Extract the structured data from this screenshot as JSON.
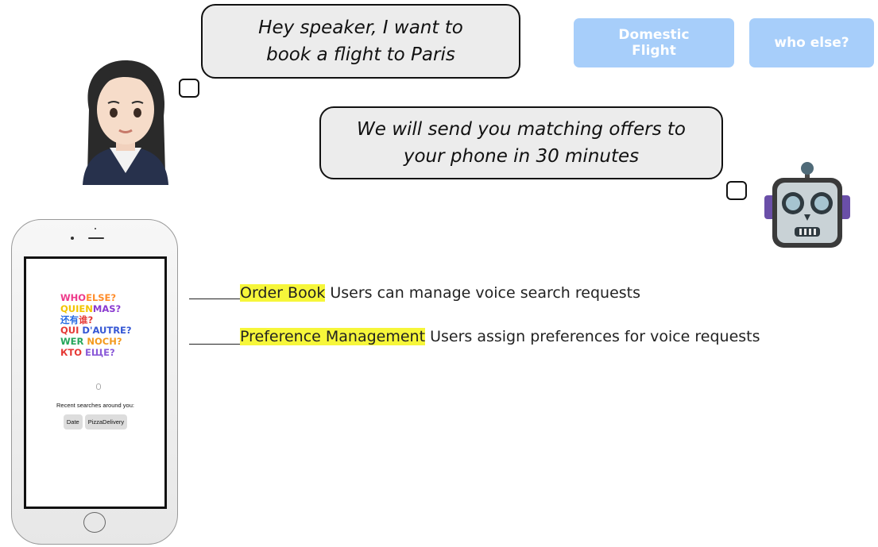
{
  "conversation": {
    "user_message": "Hey speaker, I want to book a flight to Paris",
    "assistant_message": "We will send you matching offers to your phone in 30 minutes"
  },
  "tags": {
    "domestic_flight": "Domestic Flight",
    "who_else": "who else?"
  },
  "features": [
    {
      "highlight": "Order Book",
      "description": " Users can manage voice search requests"
    },
    {
      "highlight": "Preference Management",
      "description": " Users assign preferences for voice requests"
    }
  ],
  "phone_screen": {
    "logo_lines": [
      [
        {
          "text": "WHO",
          "color": "#ee3b8b"
        },
        {
          "text": "ELSE?",
          "color": "#ff8c2a"
        }
      ],
      [
        {
          "text": "QUIEN",
          "color": "#f2c400"
        },
        {
          "text": "MAS?",
          "color": "#8a3ad0"
        }
      ],
      [
        {
          "text": "还有",
          "color": "#2a6de3"
        },
        {
          "text": "谁?",
          "color": "#e53935"
        }
      ],
      [
        {
          "text": "QUI ",
          "color": "#e53935"
        },
        {
          "text": "D'AUTRE?",
          "color": "#3557d4"
        }
      ],
      [
        {
          "text": "WER ",
          "color": "#26a65b"
        },
        {
          "text": "NOCH?",
          "color": "#f39a1e"
        }
      ],
      [
        {
          "text": "КТО ",
          "color": "#e53935"
        },
        {
          "text": "ЕЩЕ?",
          "color": "#8a5ad8"
        }
      ]
    ],
    "recent_label": "Recent searches around you:",
    "recent_chips": [
      "Date",
      "PizzaDelivery"
    ]
  },
  "colors": {
    "pill_bg": "#a7cefa",
    "highlight": "#f6f63a",
    "bubble_bg": "#ececec"
  }
}
